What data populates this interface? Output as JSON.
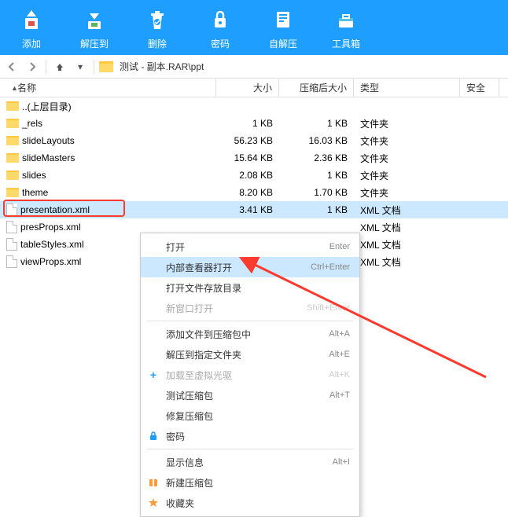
{
  "toolbar": [
    {
      "label": "添加",
      "icon": "add"
    },
    {
      "label": "解压到",
      "icon": "extract"
    },
    {
      "label": "删除",
      "icon": "delete"
    },
    {
      "label": "密码",
      "icon": "lock"
    },
    {
      "label": "自解压",
      "icon": "sfx"
    },
    {
      "label": "工具箱",
      "icon": "toolbox"
    }
  ],
  "breadcrumb": {
    "path": "测试 - 副本.RAR\\ppt"
  },
  "columns": {
    "name": "名称",
    "size": "大小",
    "compressed": "压缩后大小",
    "type": "类型",
    "security": "安全"
  },
  "rows": [
    {
      "name": "..(上层目录)",
      "size": "",
      "compressed": "",
      "type": "",
      "icon": "folder"
    },
    {
      "name": "_rels",
      "size": "1 KB",
      "compressed": "1 KB",
      "type": "文件夹",
      "icon": "folder"
    },
    {
      "name": "slideLayouts",
      "size": "56.23 KB",
      "compressed": "16.03 KB",
      "type": "文件夹",
      "icon": "folder"
    },
    {
      "name": "slideMasters",
      "size": "15.64 KB",
      "compressed": "2.36 KB",
      "type": "文件夹",
      "icon": "folder"
    },
    {
      "name": "slides",
      "size": "2.08 KB",
      "compressed": "1 KB",
      "type": "文件夹",
      "icon": "folder"
    },
    {
      "name": "theme",
      "size": "8.20 KB",
      "compressed": "1.70 KB",
      "type": "文件夹",
      "icon": "folder"
    },
    {
      "name": "presentation.xml",
      "size": "3.41 KB",
      "compressed": "1 KB",
      "type": "XML 文档",
      "icon": "file",
      "selected": true
    },
    {
      "name": "presProps.xml",
      "size": "",
      "compressed": "",
      "type": "XML 文档",
      "icon": "file"
    },
    {
      "name": "tableStyles.xml",
      "size": "",
      "compressed": "",
      "type": "XML 文档",
      "icon": "file"
    },
    {
      "name": "viewProps.xml",
      "size": "",
      "compressed": "",
      "type": "XML 文档",
      "icon": "file"
    }
  ],
  "context_menu": [
    {
      "label": "打开",
      "shortcut": "Enter",
      "type": "item"
    },
    {
      "label": "内部查看器打开",
      "shortcut": "Ctrl+Enter",
      "type": "item",
      "hover": true
    },
    {
      "label": "打开文件存放目录",
      "shortcut": "",
      "type": "item"
    },
    {
      "label": "新窗口打开",
      "shortcut": "Shift+Enter",
      "type": "item",
      "disabled": true
    },
    {
      "type": "sep"
    },
    {
      "label": "添加文件到压缩包中",
      "shortcut": "Alt+A",
      "type": "item"
    },
    {
      "label": "解压到指定文件夹",
      "shortcut": "Alt+E",
      "type": "item"
    },
    {
      "label": "加载至虚拟光驱",
      "shortcut": "Alt+K",
      "type": "item",
      "disabled": true,
      "icon": "plus"
    },
    {
      "label": "测试压缩包",
      "shortcut": "Alt+T",
      "type": "item"
    },
    {
      "label": "修复压缩包",
      "shortcut": "",
      "type": "item"
    },
    {
      "label": "密码",
      "shortcut": "",
      "type": "item",
      "icon": "lock"
    },
    {
      "type": "sep"
    },
    {
      "label": "显示信息",
      "shortcut": "Alt+I",
      "type": "item"
    },
    {
      "label": "新建压缩包",
      "shortcut": "",
      "type": "item",
      "icon": "archive"
    },
    {
      "label": "收藏夹",
      "shortcut": "",
      "type": "item",
      "icon": "star"
    }
  ]
}
